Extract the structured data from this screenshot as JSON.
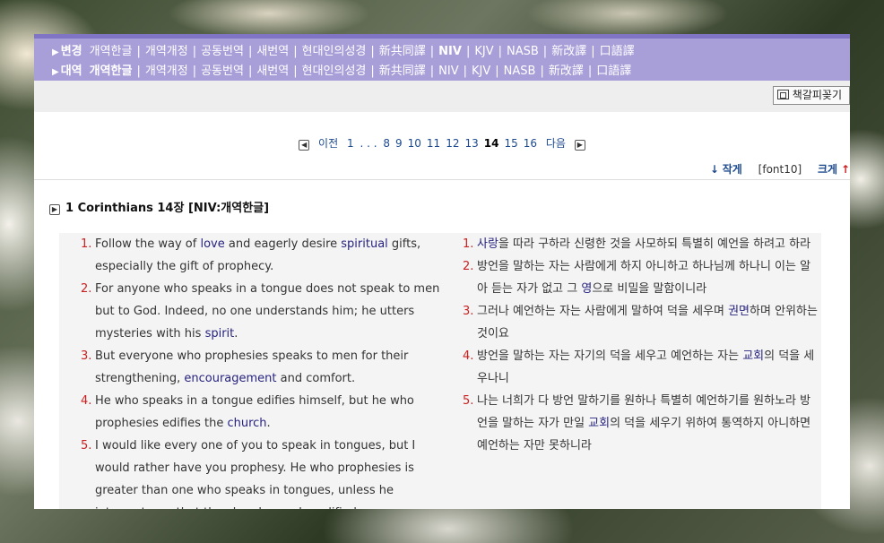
{
  "topbar": {
    "row1": {
      "label": "변경",
      "translations": [
        {
          "text": "개역한글",
          "active": false
        },
        {
          "text": "개역개정",
          "active": false
        },
        {
          "text": "공동번역",
          "active": false
        },
        {
          "text": "새번역",
          "active": false
        },
        {
          "text": "현대인의성경",
          "active": false
        },
        {
          "text": "新共同譯",
          "active": false
        },
        {
          "text": "NIV",
          "active": true
        },
        {
          "text": "KJV",
          "active": false
        },
        {
          "text": "NASB",
          "active": false
        },
        {
          "text": "新改譯",
          "active": false
        },
        {
          "text": "口語譯",
          "active": false
        }
      ]
    },
    "row2": {
      "label": "대역",
      "translations": [
        {
          "text": "개역한글",
          "active": true
        },
        {
          "text": "개역개정",
          "active": false
        },
        {
          "text": "공동번역",
          "active": false
        },
        {
          "text": "새번역",
          "active": false
        },
        {
          "text": "현대인의성경",
          "active": false
        },
        {
          "text": "新共同譯",
          "active": false
        },
        {
          "text": "NIV",
          "active": false
        },
        {
          "text": "KJV",
          "active": false
        },
        {
          "text": "NASB",
          "active": false
        },
        {
          "text": "新改譯",
          "active": false
        },
        {
          "text": "口語譯",
          "active": false
        }
      ]
    }
  },
  "bookmark_label": "책갈피꽂기",
  "pager": {
    "prev": "이전",
    "first": "1",
    "ellipsis": ". . .",
    "pages": [
      "8",
      "9",
      "10",
      "11",
      "12",
      "13",
      "14",
      "15",
      "16"
    ],
    "current": "14",
    "next": "다음"
  },
  "font_control": {
    "smaller": "작게",
    "font_name": "[font10]",
    "bigger": "크게"
  },
  "chapter_title": "1 Corinthians 14장 [NIV:개역한글]",
  "verses_en": [
    {
      "num": "1.",
      "parts": [
        {
          "t": "Follow the way of "
        },
        {
          "t": "love",
          "kw": true
        },
        {
          "t": " and eagerly desire "
        },
        {
          "t": "spiritual",
          "kw": true
        },
        {
          "t": " gifts, especially the gift of prophecy."
        }
      ]
    },
    {
      "num": "2.",
      "parts": [
        {
          "t": "For anyone who speaks in a tongue does not speak to men but to God. Indeed, no one understands him; he utters mysteries with his "
        },
        {
          "t": "spirit",
          "kw": true
        },
        {
          "t": "."
        }
      ]
    },
    {
      "num": "3.",
      "parts": [
        {
          "t": "But everyone who prophesies speaks to men for their strengthening, "
        },
        {
          "t": "encouragement",
          "kw": true
        },
        {
          "t": " and comfort."
        }
      ]
    },
    {
      "num": "4.",
      "parts": [
        {
          "t": "He who speaks in a tongue edifies himself, but he who prophesies edifies the "
        },
        {
          "t": "church",
          "kw": true
        },
        {
          "t": "."
        }
      ]
    },
    {
      "num": "5.",
      "parts": [
        {
          "t": "I would like every one of you to speak in tongues, but I would rather have you prophesy. He who prophesies is greater than one who speaks in tongues, unless he interprets, so that the church may be edified."
        }
      ]
    }
  ],
  "verses_ko": [
    {
      "num": "1.",
      "parts": [
        {
          "t": "사랑",
          "kw": true
        },
        {
          "t": "을 따라 구하라 신령한 것을 사모하되 특별히 예언을 하려고 하라"
        }
      ]
    },
    {
      "num": "2.",
      "parts": [
        {
          "t": "방언을 말하는 자는 사람에게 하지 아니하고 하나님께 하나니 이는 알아 듣는 자가 없고 그 "
        },
        {
          "t": "영",
          "kw": true
        },
        {
          "t": "으로 비밀을 말함이니라"
        }
      ]
    },
    {
      "num": "3.",
      "parts": [
        {
          "t": "그러나 예언하는 자는 사람에게 말하여 덕을 세우며 "
        },
        {
          "t": "권면",
          "kw": true
        },
        {
          "t": "하며 안위하는 것이요"
        }
      ]
    },
    {
      "num": "4.",
      "parts": [
        {
          "t": "방언을 말하는 자는 자기의 덕을 세우고 예언하는 자는 "
        },
        {
          "t": "교회",
          "kw": true
        },
        {
          "t": "의 덕을 세우나니"
        }
      ]
    },
    {
      "num": "5.",
      "parts": [
        {
          "t": "나는 너희가 다 방언 말하기를 원하나 특별히 예언하기를 원하노라 방언을 말하는 자가 만일 "
        },
        {
          "t": "교회",
          "kw": true
        },
        {
          "t": "의 덕을 세우기 위하여 통역하지 아니하면 예언하는 자만 못하니라"
        }
      ]
    }
  ],
  "colors": {
    "topbar": "#a89fd8",
    "topbar_border": "#7f75c4",
    "link": "#1d4a8f",
    "keyword": "#27237e",
    "verse_num": "#cc1f1f"
  }
}
